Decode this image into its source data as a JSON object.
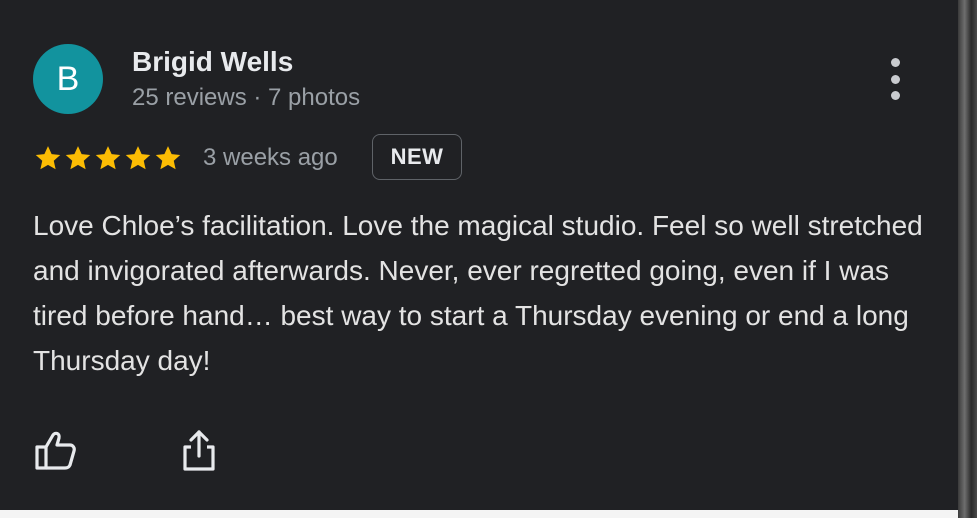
{
  "review": {
    "avatar_letter": "B",
    "reviewer_name": "Brigid Wells",
    "reviewer_meta": "25 reviews · 7 photos",
    "rating": 5,
    "rating_max": 5,
    "time_ago": "3 weeks ago",
    "badge": "NEW",
    "text": "Love Chloe’s facilitation. Love the magical studio. Feel so well stretched and invigorated afterwards. Never, ever regretted going, even if I was tired before hand… best way to start a Thursday evening or end a long Thursday day!"
  },
  "icons": {
    "menu": "more-vert-icon",
    "star": "star-icon",
    "like": "thumbs-up-icon",
    "share": "share-icon"
  },
  "colors": {
    "background": "#202124",
    "avatar": "#12939e",
    "star": "#fbbc04",
    "name": "#e8eaed",
    "secondary": "#9aa0a6"
  }
}
